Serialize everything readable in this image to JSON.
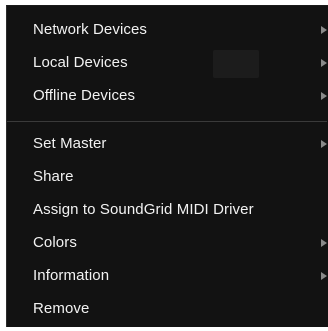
{
  "menu": {
    "items": [
      {
        "label": "Network Devices",
        "submenu": true
      },
      {
        "label": "Local Devices",
        "submenu": true
      },
      {
        "label": "Offline Devices",
        "submenu": true
      },
      {
        "label": "Set Master",
        "submenu": true
      },
      {
        "label": "Share",
        "submenu": false
      },
      {
        "label": "Assign to SoundGrid MIDI Driver",
        "submenu": false
      },
      {
        "label": "Colors",
        "submenu": true
      },
      {
        "label": "Information",
        "submenu": true
      },
      {
        "label": "Remove",
        "submenu": false
      }
    ]
  },
  "colors": {
    "menu_background": "#121212",
    "text": "#f2f2f2",
    "separator": "#3a3a3a",
    "submenu_arrow": "#8a8a8a"
  }
}
